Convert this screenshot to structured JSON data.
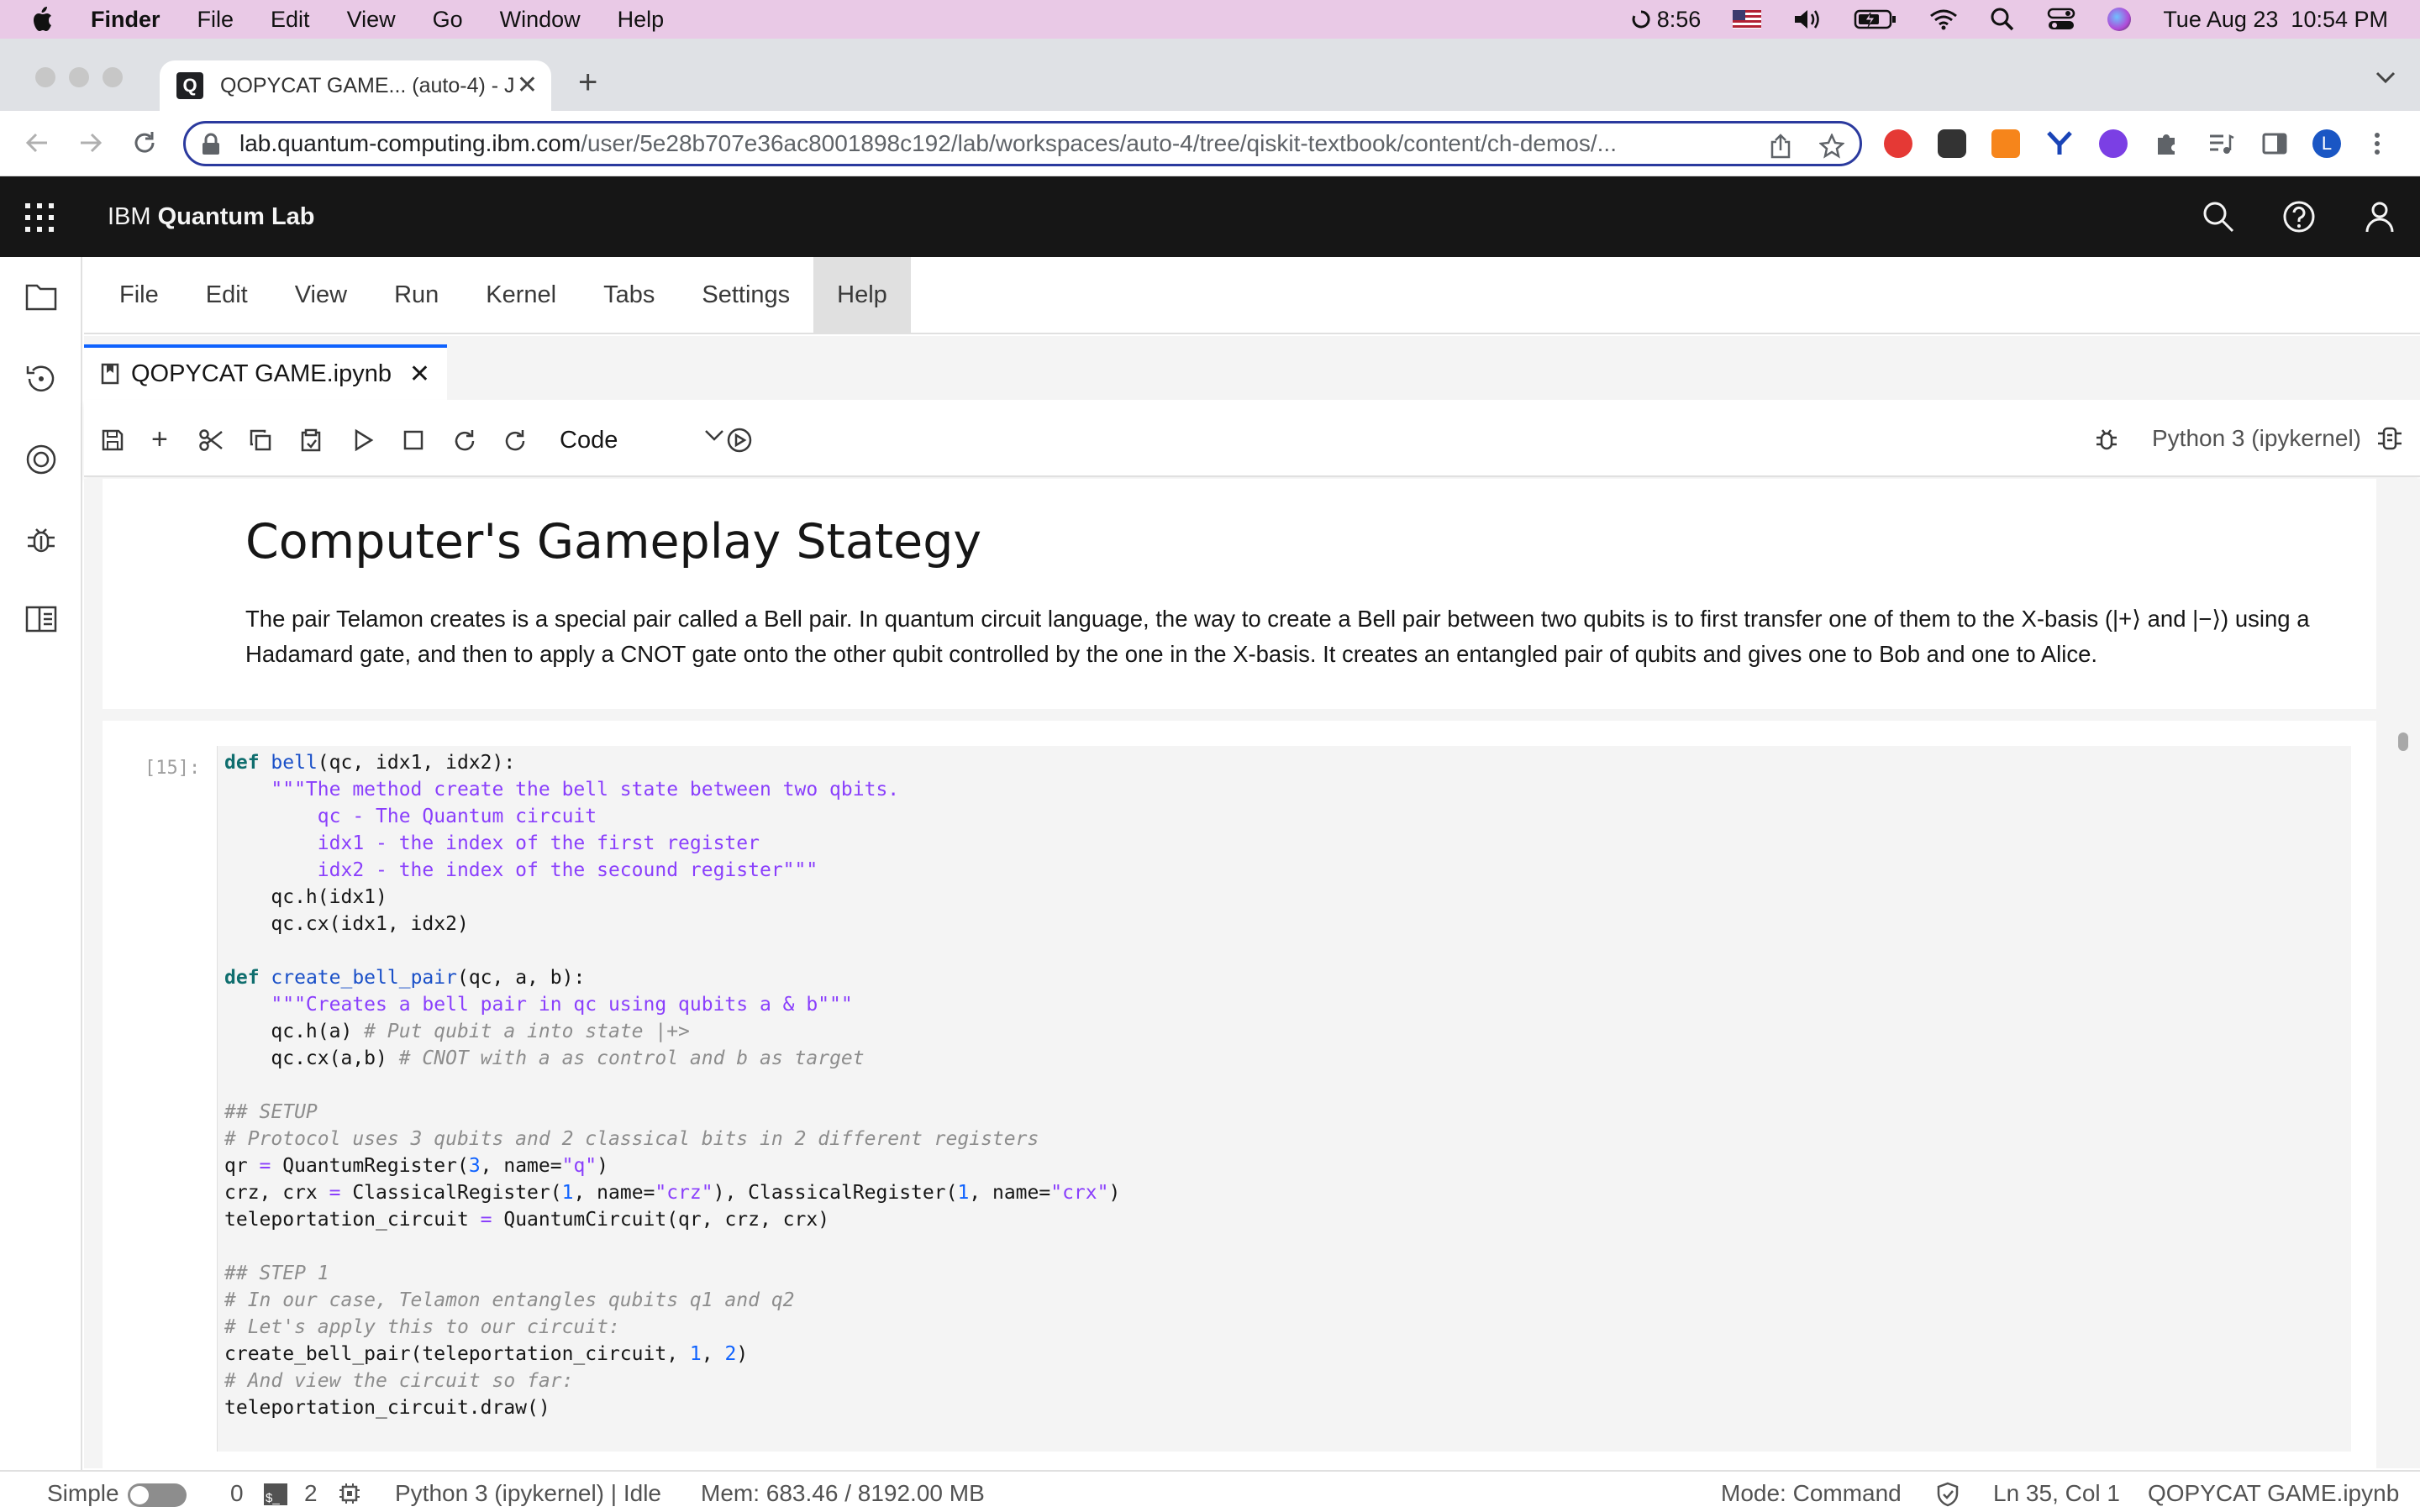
{
  "mac_menubar": {
    "app_name": "Finder",
    "menus": [
      "File",
      "Edit",
      "View",
      "Go",
      "Window",
      "Help"
    ],
    "timer": "8:56",
    "datetime": "Tue Aug 23  10:54 PM"
  },
  "browser": {
    "tab_title": "QOPYCAT GAME... (auto-4) - J",
    "tab_favicon_letter": "Q",
    "url_host": "lab.quantum-computing.ibm.com",
    "url_path": "/user/5e28b707e36ac8001898c192/lab/workspaces/auto-4/tree/qiskit-textbook/content/ch-demos/...",
    "profile_initial": "L"
  },
  "ibm_header": {
    "brand_prefix": "IBM",
    "brand_name": "Quantum Lab"
  },
  "lab_menu": [
    "File",
    "Edit",
    "View",
    "Run",
    "Kernel",
    "Tabs",
    "Settings",
    "Help"
  ],
  "doc_tab": {
    "title": "QOPYCAT GAME.ipynb"
  },
  "toolbar": {
    "cell_type": "Code",
    "kernel_name": "Python 3 (ipykernel)"
  },
  "markdown_cell": {
    "heading": "Computer's Gameplay Stategy",
    "paragraph": "The pair Telamon creates is a special pair called a Bell pair. In quantum circuit language, the way to create a Bell pair between two qubits is to first transfer one of them to the X-basis (|+⟩ and |−⟩) using a Hadamard gate, and then to apply a CNOT gate onto the other qubit controlled by the one in the X-basis. It creates an entangled pair of qubits and gives one to Bob and one to Alice."
  },
  "code_cell": {
    "prompt": "[15]:",
    "lines": [
      "def bell(qc, idx1, idx2):",
      "    \"\"\"The method create the bell state between two qbits.",
      "        qc - The Quantum circuit",
      "        idx1 - the index of the first register",
      "        idx2 - the index of the secound register\"\"\"",
      "    qc.h(idx1)",
      "    qc.cx(idx1, idx2)",
      "",
      "def create_bell_pair(qc, a, b):",
      "    \"\"\"Creates a bell pair in qc using qubits a & b\"\"\"",
      "    qc.h(a) # Put qubit a into state |+>",
      "    qc.cx(a,b) # CNOT with a as control and b as target",
      "",
      "## SETUP",
      "# Protocol uses 3 qubits and 2 classical bits in 2 different registers",
      "qr = QuantumRegister(3, name=\"q\")",
      "crz, crx = ClassicalRegister(1, name=\"crz\"), ClassicalRegister(1, name=\"crx\")",
      "teleportation_circuit = QuantumCircuit(qr, crz, crx)",
      "",
      "## STEP 1",
      "# In our case, Telamon entangles qubits q1 and q2",
      "# Let's apply this to our circuit:",
      "create_bell_pair(teleportation_circuit, 1, 2)",
      "# And view the circuit so far:",
      "teleportation_circuit.draw()"
    ]
  },
  "status_bar": {
    "mode_label": "Simple",
    "count_a": "0",
    "count_b": "2",
    "kernel_status": "Python 3 (ipykernel) | Idle",
    "memory": "Mem: 683.46 / 8192.00 MB",
    "mode": "Mode: Command",
    "cursor": "Ln 35, Col 1",
    "filename": "QOPYCAT GAME.ipynb"
  },
  "colors": {
    "accent": "#0f62fe",
    "header_bg": "#161616",
    "menubar_bg": "#e9c9e6"
  }
}
